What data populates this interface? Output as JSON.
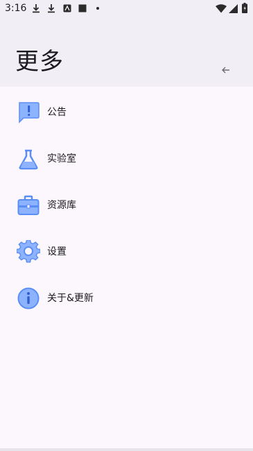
{
  "status_bar": {
    "time": "3:16",
    "icons": [
      "download-icon",
      "download-icon",
      "app-notification-icon",
      "stop-icon",
      "dot-icon",
      "wifi-icon",
      "signal-icon",
      "battery-icon"
    ]
  },
  "header": {
    "title": "更多",
    "back_icon": "arrow-left-icon"
  },
  "menu": {
    "items": [
      {
        "label": "公告",
        "icon": "announcement-icon"
      },
      {
        "label": "实验室",
        "icon": "flask-icon"
      },
      {
        "label": "资源库",
        "icon": "briefcase-icon"
      },
      {
        "label": "设置",
        "icon": "gear-icon"
      },
      {
        "label": "关于&更新",
        "icon": "info-icon"
      }
    ]
  },
  "colors": {
    "accent": "#6d9eff",
    "header_bg": "#f1eff5",
    "body_bg": "#fcf7fd",
    "text": "#1c1b1f"
  }
}
